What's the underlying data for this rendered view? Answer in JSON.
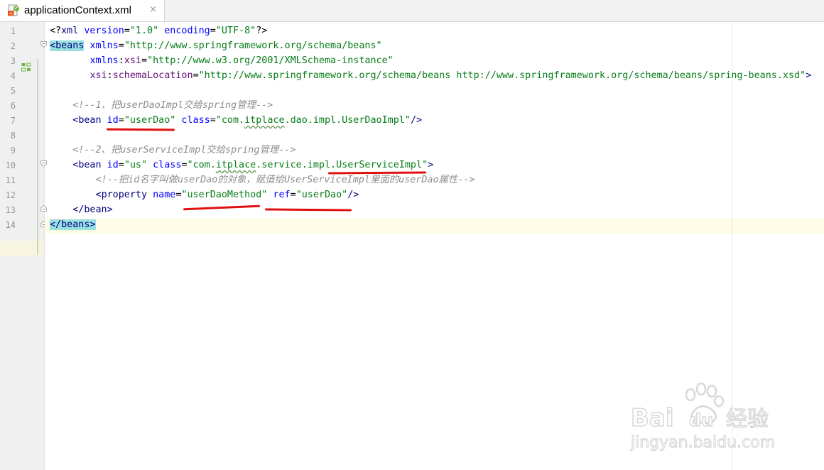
{
  "tab": {
    "title": "applicationContext.xml",
    "close_glyph": "×",
    "icon": "spring-xml-file-icon"
  },
  "gutter": {
    "line_numbers": [
      "1",
      "2",
      "3",
      "4",
      "5",
      "6",
      "7",
      "8",
      "9",
      "10",
      "11",
      "12",
      "13",
      "14"
    ],
    "current_line": 14
  },
  "code": {
    "l1": {
      "a": "<?",
      "b": "xml",
      "c": " version",
      "d": "=",
      "e": "\"1.0\"",
      "f": " encoding",
      "g": "=",
      "h": "\"UTF-8\"",
      "i": "?>"
    },
    "l2": {
      "a": "<",
      "b": "beans",
      "c": " xmlns",
      "d": "=",
      "e": "\"http://www.springframework.org/schema/beans\""
    },
    "l3": {
      "indent": "       ",
      "a": "xmlns",
      "b": ":",
      "c": "xsi",
      "d": "=",
      "e": "\"http://www.w3.org/2001/XMLSchema-instance\""
    },
    "l4": {
      "indent": "       ",
      "a": "xsi",
      "b": ":",
      "c": "schemaLocation",
      "d": "=",
      "e": "\"http://www.springframework.org/schema/beans http://www.springframework.org/schema/beans/spring-beans.xsd\"",
      "f": ">"
    },
    "l6": {
      "indent": "    ",
      "a": "<!--1、",
      "b": "把",
      "c": "userDaoImpl",
      "d": "交给",
      "e": "spring",
      "f": "管理",
      "g": "-->"
    },
    "l7": {
      "indent": "    ",
      "a": "<",
      "b": "bean",
      "c": " id",
      "d": "=",
      "e": "\"userDao\"",
      "f": " class",
      "g": "=",
      "h": "\"com.",
      "i": "itplace",
      "j": ".dao.impl.UserDaoImpl\"",
      "k": "/>"
    },
    "l9": {
      "indent": "    ",
      "a": "<!--2、",
      "b": "把",
      "c": "userServiceImpl",
      "d": "交给",
      "e": "spring",
      "f": "管理",
      "g": "-->"
    },
    "l10": {
      "indent": "    ",
      "a": "<",
      "b": "bean",
      "c": " id",
      "d": "=",
      "e": "\"us\"",
      "f": " class",
      "g": "=",
      "h": "\"com.",
      "i": "itplace",
      "j": ".service.impl.",
      "k": "UserServiceImpl",
      "l": "\"",
      "m": ">"
    },
    "l11": {
      "indent": "        ",
      "a": "<!--",
      "b": "把",
      "c": "id",
      "d": "名字叫做",
      "e": "userDao",
      "f": "的对象，赋值给",
      "g": "UserServiceImpl",
      "h": "里面的",
      "i": "userDao",
      "j": "属性",
      "k": "-->"
    },
    "l12": {
      "indent": "        ",
      "a": "<",
      "b": "property",
      "c": " name",
      "d": "=",
      "e": "\"userDaoMethod\"",
      "f": " ref",
      "g": "=",
      "h": "\"userDao\"",
      "i": "/>"
    },
    "l13": {
      "indent": "    ",
      "a": "</",
      "b": "bean",
      "c": ">"
    },
    "l14": {
      "a": "</",
      "b": "beans",
      "c": ">"
    }
  },
  "colors": {
    "tag": "#000080",
    "attribute": "#0000ff",
    "namespace": "#660e7a",
    "value": "#067d17",
    "comment": "#8c8c8c",
    "annotation_red": "#e01010",
    "brace_highlight": "#99e0e0"
  },
  "watermark": {
    "brand_left": "Bai",
    "brand_right": "du",
    "cn": "经验",
    "url": "jingyan.baidu.com"
  }
}
